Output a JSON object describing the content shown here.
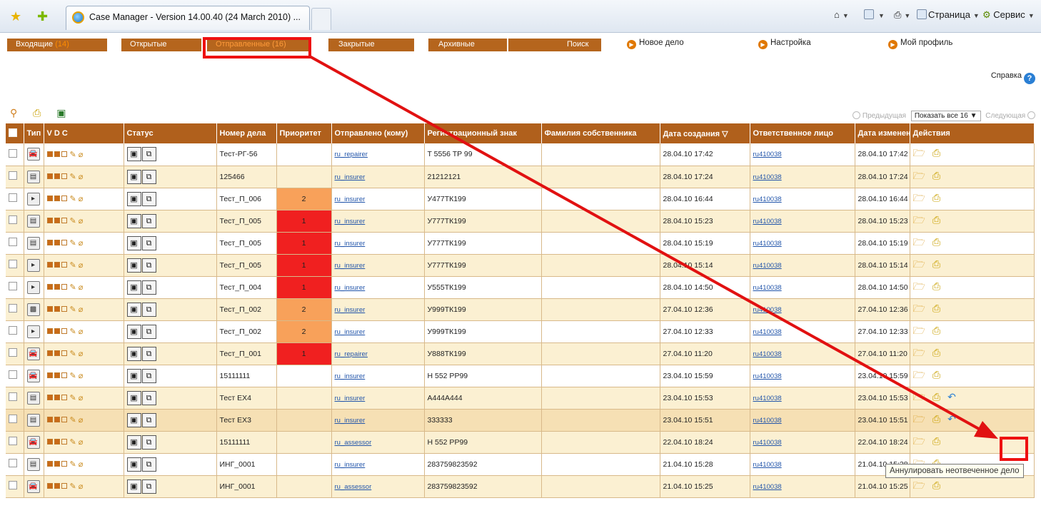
{
  "browser": {
    "tab_title": "Case Manager - Version 14.00.40 (24 March 2010) ...",
    "commands": [
      "Страница",
      "Сервис"
    ]
  },
  "nav": {
    "tabs": [
      {
        "label": "Входящие",
        "count": "(14)"
      },
      {
        "label": "Открытые",
        "count": ""
      },
      {
        "label": "Отправленные",
        "count": "(16)"
      },
      {
        "label": "Закрытые",
        "count": ""
      },
      {
        "label": "Архивные",
        "count": ""
      },
      {
        "label": "Поиск",
        "count": ""
      }
    ],
    "links": [
      "Новое дело",
      "Настройка",
      "Мой профиль"
    ],
    "help": "Справка"
  },
  "pager": {
    "prev": "Предыдущая",
    "show_all": "Показать все 16",
    "next": "Следующая"
  },
  "table": {
    "headers": [
      "Тип",
      "V D C",
      "Статус",
      "Номер дела",
      "Приоритет",
      "Отправлено (кому)",
      "Регистрационный знак",
      "Фамилия собственника",
      "Дата создания",
      "Ответственное лицо",
      "Дата изменения",
      "Действия"
    ],
    "rows": [
      {
        "num": "Тест-РГ-56",
        "pri": "",
        "to": "ru_repairer",
        "reg": "T 5556 TP 99",
        "created": "28.04.10 17:42",
        "resp": "ru410038",
        "changed": "28.04.10 17:42"
      },
      {
        "num": "125466",
        "pri": "",
        "to": "ru_insurer",
        "reg": "21212121",
        "created": "28.04.10 17:24",
        "resp": "ru410038",
        "changed": "28.04.10 17:24"
      },
      {
        "num": "Тест_П_006",
        "pri": "2",
        "to": "ru_insurer",
        "reg": "У477ТК199",
        "created": "28.04.10 16:44",
        "resp": "ru410038",
        "changed": "28.04.10 16:44"
      },
      {
        "num": "Тест_П_005",
        "pri": "1",
        "to": "ru_insurer",
        "reg": "У777ТК199",
        "created": "28.04.10 15:23",
        "resp": "ru410038",
        "changed": "28.04.10 15:23"
      },
      {
        "num": "Тест_П_005",
        "pri": "1",
        "to": "ru_insurer",
        "reg": "У777ТК199",
        "created": "28.04.10 15:19",
        "resp": "ru410038",
        "changed": "28.04.10 15:19"
      },
      {
        "num": "Тест_П_005",
        "pri": "1",
        "to": "ru_insurer",
        "reg": "У777ТК199",
        "created": "28.04.10 15:14",
        "resp": "ru410038",
        "changed": "28.04.10 15:14"
      },
      {
        "num": "Тест_П_004",
        "pri": "1",
        "to": "ru_insurer",
        "reg": "У555ТК199",
        "created": "28.04.10 14:50",
        "resp": "ru410038",
        "changed": "28.04.10 14:50"
      },
      {
        "num": "Тест_П_002",
        "pri": "2",
        "to": "ru_insurer",
        "reg": "У999ТК199",
        "created": "27.04.10 12:36",
        "resp": "ru410038",
        "changed": "27.04.10 12:36"
      },
      {
        "num": "Тест_П_002",
        "pri": "2",
        "to": "ru_insurer",
        "reg": "У999ТК199",
        "created": "27.04.10 12:33",
        "resp": "ru410038",
        "changed": "27.04.10 12:33"
      },
      {
        "num": "Тест_П_001",
        "pri": "1",
        "to": "ru_repairer",
        "reg": "У888ТК199",
        "created": "27.04.10 11:20",
        "resp": "ru410038",
        "changed": "27.04.10 11:20"
      },
      {
        "num": "15111111",
        "pri": "",
        "to": "ru_insurer",
        "reg": "H 552 PP99",
        "created": "23.04.10 15:59",
        "resp": "ru410038",
        "changed": "23.04.10 15:59"
      },
      {
        "num": "Тест EX4",
        "pri": "",
        "to": "ru_insurer",
        "reg": "A444A444",
        "created": "23.04.10 15:53",
        "resp": "ru410038",
        "changed": "23.04.10 15:53"
      },
      {
        "num": "Тест EX3",
        "pri": "",
        "to": "ru_insurer",
        "reg": "333333",
        "created": "23.04.10 15:51",
        "resp": "ru410038",
        "changed": "23.04.10 15:51"
      },
      {
        "num": "15111111",
        "pri": "",
        "to": "ru_assessor",
        "reg": "H 552 PP99",
        "created": "22.04.10 18:24",
        "resp": "ru410038",
        "changed": "22.04.10 18:24"
      },
      {
        "num": "ИНГ_0001",
        "pri": "",
        "to": "ru_insurer",
        "reg": "283759823592",
        "created": "21.04.10 15:28",
        "resp": "ru410038",
        "changed": "21.04.10 15:28"
      },
      {
        "num": "ИНГ_0001",
        "pri": "",
        "to": "ru_assessor",
        "reg": "283759823592",
        "created": "21.04.10 15:25",
        "resp": "ru410038",
        "changed": "21.04.10 15:25"
      }
    ]
  },
  "tooltip": "Аннулировать неотвеченное дело",
  "annotation_color": "#e11111"
}
